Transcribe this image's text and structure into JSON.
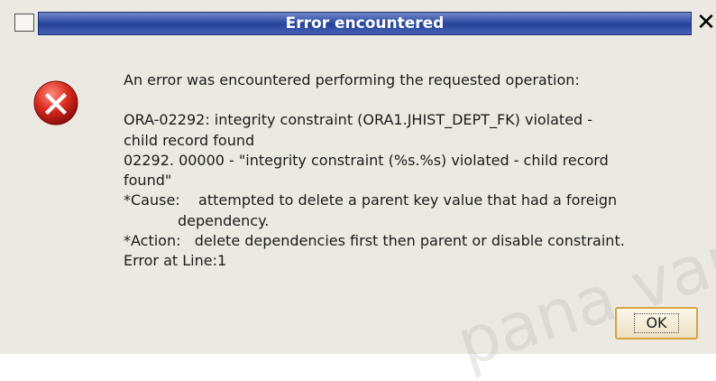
{
  "dialog": {
    "title": "Error encountered",
    "close_glyph": "✕",
    "message_lines": {
      "l1": "An error was encountered performing the requested operation:",
      "l2": "ORA-02292: integrity constraint (ORA1.JHIST_DEPT_FK) violated -",
      "l3": "child record found",
      "l4": "02292. 00000 - \"integrity constraint (%s.%s) violated - child record",
      "l5": "found\"",
      "l6": "*Cause:    attempted to delete a parent key value that had a foreign",
      "l7": "dependency.",
      "l8": "*Action:   delete dependencies first then parent or disable constraint.",
      "l9": "Error at Line:1"
    },
    "ok_label": "OK",
    "icon": "error-x-icon",
    "title_color": "#2f4ea3",
    "error_color": "#cc1d1d"
  },
  "watermark": {
    "text": "pana var@"
  }
}
